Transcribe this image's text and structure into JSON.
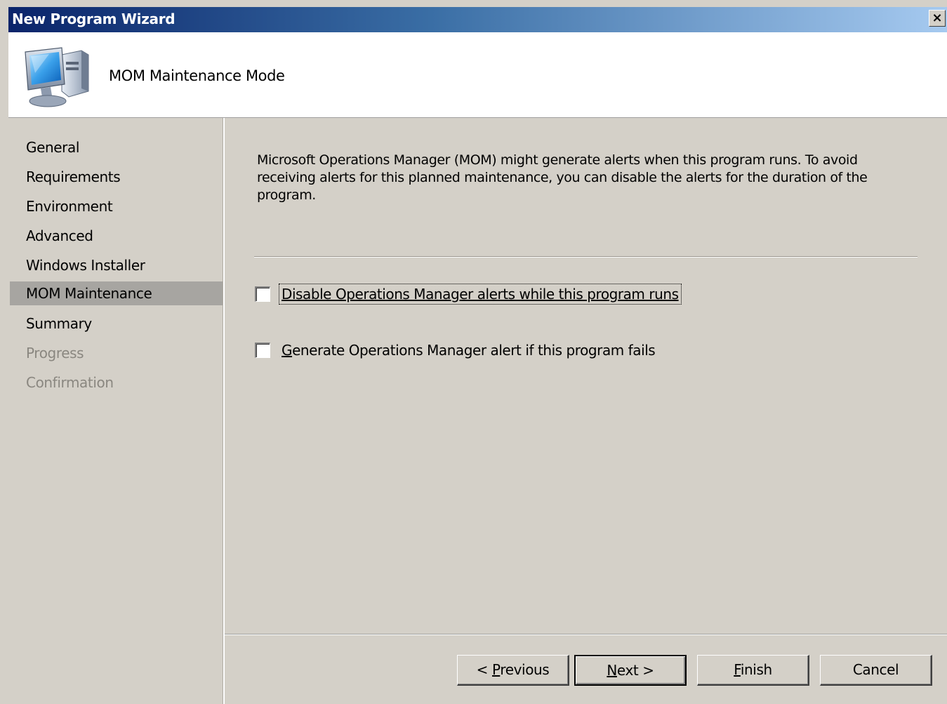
{
  "window": {
    "title": "New Program Wizard",
    "close_label": "×"
  },
  "banner": {
    "icon": "computer-monitor-icon",
    "title": "MOM Maintenance Mode"
  },
  "nav": {
    "items": [
      {
        "label": "General",
        "state": "normal"
      },
      {
        "label": "Requirements",
        "state": "normal"
      },
      {
        "label": "Environment",
        "state": "normal"
      },
      {
        "label": "Advanced",
        "state": "normal"
      },
      {
        "label": "Windows Installer",
        "state": "normal"
      },
      {
        "label": "MOM Maintenance",
        "state": "active"
      },
      {
        "label": "Summary",
        "state": "normal"
      },
      {
        "label": "Progress",
        "state": "disabled"
      },
      {
        "label": "Confirmation",
        "state": "disabled"
      }
    ]
  },
  "main": {
    "description": "Microsoft Operations Manager (MOM) might generate alerts when this program runs. To avoid receiving alerts for this planned maintenance, you can disable the alerts for the duration of the program.",
    "options": [
      {
        "label": "Disable Operations Manager alerts while this program runs",
        "checked": false,
        "focused": true
      },
      {
        "label_accel": "G",
        "label_rest": "enerate Operations Manager alert if this program fails",
        "checked": false,
        "focused": false
      }
    ]
  },
  "buttons": {
    "previous": {
      "prefix": "< ",
      "accel": "P",
      "rest": "revious"
    },
    "next": {
      "accel": "N",
      "rest": "ext >"
    },
    "finish": {
      "accel": "F",
      "rest": "inish"
    },
    "cancel": {
      "label": "Cancel"
    }
  },
  "colors": {
    "title_gradient_start": "#0a246a",
    "title_gradient_end": "#a6caf0",
    "face": "#d4d0c8",
    "nav_active": "#a7a5a1",
    "disabled_text": "#8a8780"
  }
}
